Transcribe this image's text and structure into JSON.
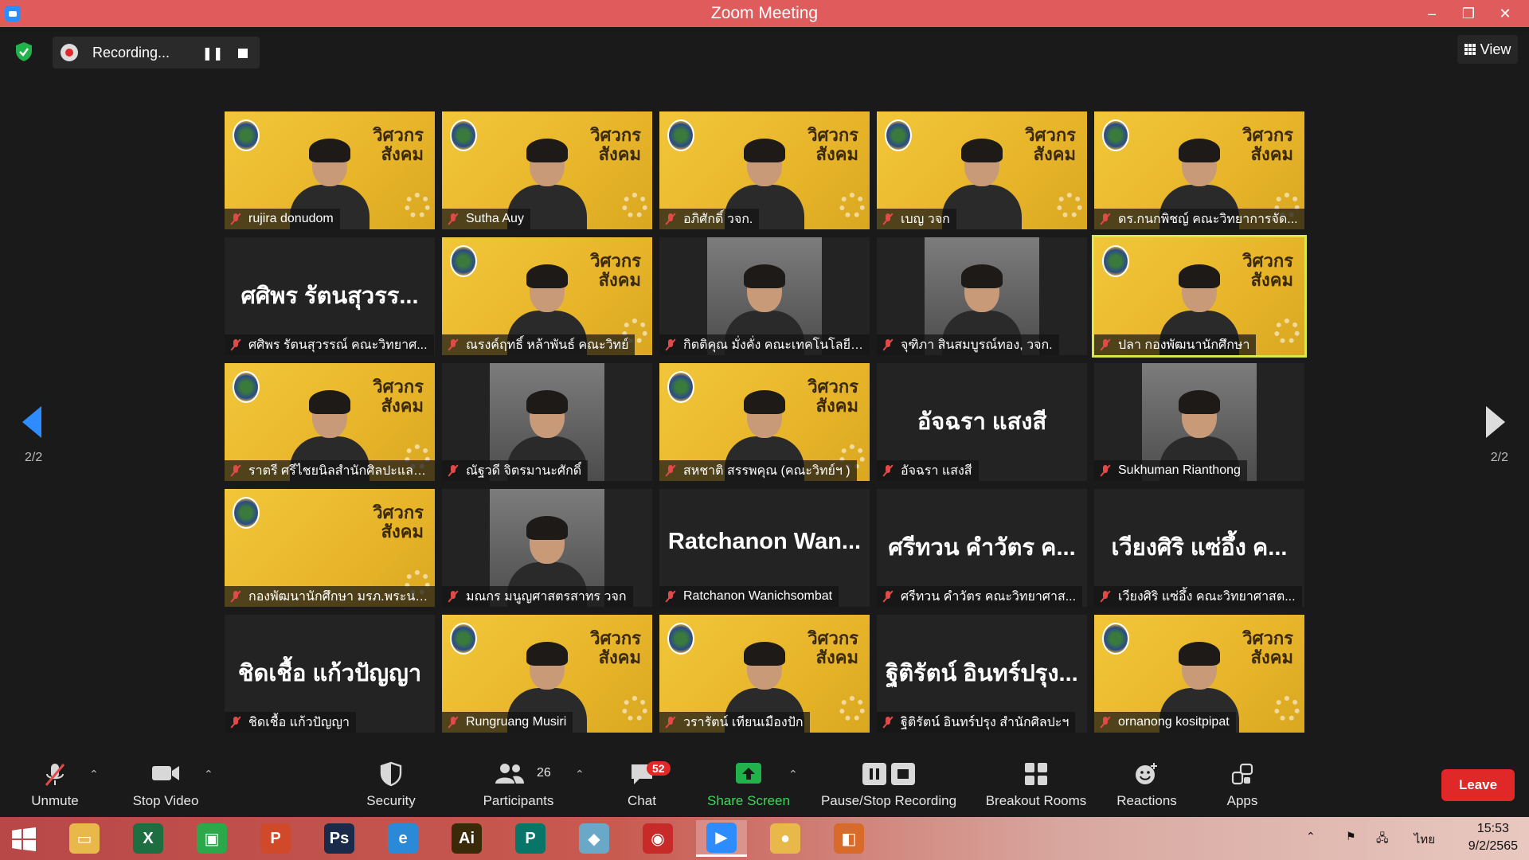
{
  "window": {
    "title": "Zoom Meeting",
    "controls": {
      "minimize": "–",
      "restore": "❐",
      "close": "✕"
    }
  },
  "topbar": {
    "recording_label": "Recording...",
    "pause_glyph": "❚❚",
    "view_label": "View"
  },
  "pagination": {
    "left": "2/2",
    "right": "2/2"
  },
  "tiles": [
    {
      "id": "rujira",
      "name": "rujira donudom",
      "bg": "yellow"
    },
    {
      "id": "sutha",
      "name": "Sutha Auy",
      "bg": "yellow"
    },
    {
      "id": "apisak",
      "name": "อภิศักดิ์ วจก.",
      "bg": "yellow"
    },
    {
      "id": "benyu",
      "name": "เบญ วจก",
      "bg": "yellow"
    },
    {
      "id": "kanokpich",
      "name": "ดร.กนกพิชญ์ คณะวิทยาการจัด...",
      "bg": "yellow"
    },
    {
      "id": "sasiporn",
      "name": "ศศิพร รัตนสุวรรณ์ คณะวิทยาศ...",
      "bigname": "ศศิพร รัตนสุวรร...",
      "bg": "none"
    },
    {
      "id": "narongsak",
      "name": "ณรงค์ฤทธิ์ หล้าพันธ์ คณะวิทย์",
      "bg": "yellow"
    },
    {
      "id": "kittikun",
      "name": "กิตติคุณ มั่งคั่ง คณะเทคโนโลยีอุ...",
      "bg": "photo"
    },
    {
      "id": "juthipa",
      "name": "จุฑิภา สินสมบูรณ์ทอง, วจก.",
      "bg": "photo"
    },
    {
      "id": "pla",
      "name": "ปลา กองพัฒนานักศึกษา",
      "bg": "yellow",
      "active": true
    },
    {
      "id": "ratree",
      "name": "ราตรี   ศรีไชยนิลสำนักศิลปะและวั...",
      "bg": "yellow"
    },
    {
      "id": "nattha",
      "name": "ณัฐวดี จิตรมานะศักดิ์",
      "bg": "photo"
    },
    {
      "id": "sahachat",
      "name": "สหชาติ สรรพคุณ (คณะวิทย์ฯ )",
      "bg": "yellow"
    },
    {
      "id": "atchara",
      "name": "อัจฉรา แสงสี",
      "bigname": "อัจฉรา แสงสี",
      "bg": "none"
    },
    {
      "id": "sukhuman",
      "name": "Sukhuman Rianthong",
      "bg": "photo"
    },
    {
      "id": "kong",
      "name": "กองพัฒนานักศึกษา มรภ.พระนคร",
      "bg": "yellow-logo"
    },
    {
      "id": "manakorn",
      "name": "มณกร มนูญศาสตรสาทร วจก",
      "bg": "photo"
    },
    {
      "id": "ratchanon",
      "name": "Ratchanon Wanichsombat",
      "bigname": "Ratchanon  Wan...",
      "bg": "none"
    },
    {
      "id": "sriuan",
      "name": "ศรีทวน  คำวัตร คณะวิทยาศาส...",
      "bigname": "ศรีทวน  คำวัตร ค...",
      "bg": "none"
    },
    {
      "id": "wiangsiri",
      "name": "เวียงศิริ  แซ่อึ้ง  คณะวิทยาศาสต...",
      "bigname": "เวียงศิริ  แซ่อึ้ง  ค...",
      "bg": "none"
    },
    {
      "id": "chidchua",
      "name": "ชิดเชื้อ แก้วปัญญา",
      "bigname": "ชิดเชื้อ แก้วปัญญา",
      "bg": "none"
    },
    {
      "id": "rungruang",
      "name": "Rungruang Musiri",
      "bg": "yellow"
    },
    {
      "id": "wararat",
      "name": "วรารัตน์ เทียนเมืองปัก",
      "bg": "yellow"
    },
    {
      "id": "thitirat",
      "name": "ฐิติรัตน์ อินทร์ปรุง สำนักศิลปะฯ",
      "bigname": "ฐิติรัตน์ อินทร์ปรุง...",
      "bg": "none"
    },
    {
      "id": "ornanong",
      "name": "ornanong kositpipat",
      "bg": "yellow"
    }
  ],
  "banner_text": {
    "line1": "วิศวกร",
    "line2": "สังคม"
  },
  "toolbar": {
    "unmute": "Unmute",
    "stop_video": "Stop Video",
    "security": "Security",
    "participants": "Participants",
    "participants_count": "26",
    "chat": "Chat",
    "chat_badge": "52",
    "share_screen": "Share Screen",
    "pause_stop_recording": "Pause/Stop Recording",
    "breakout_rooms": "Breakout Rooms",
    "reactions": "Reactions",
    "apps": "Apps",
    "leave": "Leave"
  },
  "taskbar": {
    "apps": [
      {
        "name": "file-explorer",
        "glyph": "▭",
        "color": "#e8b84a"
      },
      {
        "name": "excel",
        "glyph": "X",
        "color": "#1d6f42"
      },
      {
        "name": "store",
        "glyph": "▣",
        "color": "#2aa84a"
      },
      {
        "name": "powerpoint",
        "glyph": "P",
        "color": "#d04a2a"
      },
      {
        "name": "photoshop",
        "glyph": "Ps",
        "color": "#1a2a4a"
      },
      {
        "name": "internet-explorer",
        "glyph": "e",
        "color": "#2a8ad8"
      },
      {
        "name": "illustrator",
        "glyph": "Ai",
        "color": "#3a2a0a"
      },
      {
        "name": "publisher",
        "glyph": "P",
        "color": "#077568"
      },
      {
        "name": "notes",
        "glyph": "◆",
        "color": "#6aa8c8"
      },
      {
        "name": "photoscape",
        "glyph": "◉",
        "color": "#c82a2a"
      },
      {
        "name": "zoom",
        "glyph": "▶",
        "color": "#2d8cff"
      },
      {
        "name": "chrome",
        "glyph": "●",
        "color": "#e8b84a"
      },
      {
        "name": "photos",
        "glyph": "◧",
        "color": "#d86a2a"
      }
    ],
    "language": "ไทย",
    "time": "15:53",
    "date": "9/2/2565"
  }
}
